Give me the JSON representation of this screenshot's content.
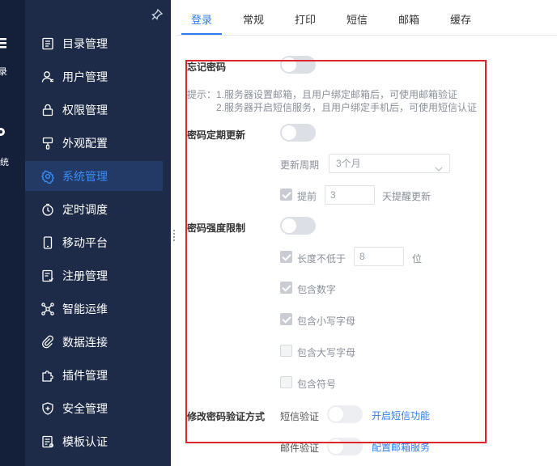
{
  "rail": {
    "items": [
      {
        "icon": "list-icon",
        "label": "录"
      },
      {
        "icon": "gear-icon",
        "label": "系统"
      }
    ]
  },
  "sidebar": {
    "pin_icon": "pin-icon",
    "items": [
      {
        "label": "目录管理",
        "icon": "catalog-icon"
      },
      {
        "label": "用户管理",
        "icon": "user-icon"
      },
      {
        "label": "权限管理",
        "icon": "lock-icon"
      },
      {
        "label": "外观配置",
        "icon": "brush-icon"
      },
      {
        "label": "系统管理",
        "icon": "gear-icon",
        "active": true
      },
      {
        "label": "定时调度",
        "icon": "timer-icon"
      },
      {
        "label": "移动平台",
        "icon": "mobile-icon"
      },
      {
        "label": "注册管理",
        "icon": "register-icon"
      },
      {
        "label": "智能运维",
        "icon": "ops-icon"
      },
      {
        "label": "数据连接",
        "icon": "link-icon"
      },
      {
        "label": "插件管理",
        "icon": "plugin-icon"
      },
      {
        "label": "安全管理",
        "icon": "shield-icon"
      },
      {
        "label": "模板认证",
        "icon": "template-icon"
      }
    ]
  },
  "tabs": [
    "登录",
    "常规",
    "打印",
    "短信",
    "邮箱",
    "缓存"
  ],
  "active_tab": "登录",
  "form": {
    "forgot_password": {
      "label": "忘记密码",
      "enabled": false
    },
    "hint_line1": "提示：1.服务器设置邮箱，且用户绑定邮箱后，可使用邮箱验证",
    "hint_line2": "2.服务器开启短信服务，且用户绑定手机后，可使用短信认证",
    "periodic_update": {
      "label": "密码定期更新",
      "enabled": false,
      "period_label": "更新周期",
      "period_value": "3个月",
      "remind_label": "提前",
      "remind_checked": true,
      "remind_days": "3",
      "remind_suffix": "天提醒更新"
    },
    "strength": {
      "label": "密码强度限制",
      "enabled": false,
      "length_label": "长度不低于",
      "length_checked": true,
      "length_value": "8",
      "length_unit": "位",
      "digits_label": "包含数字",
      "digits_checked": true,
      "lower_label": "包含小写字母",
      "lower_checked": true,
      "upper_label": "包含大写字母",
      "upper_checked": false,
      "symbol_label": "包含符号",
      "symbol_checked": false
    },
    "verify": {
      "label": "修改密码验证方式",
      "sms_label": "短信验证",
      "sms_enabled": false,
      "sms_link": "开启短信功能",
      "email_label": "邮件验证",
      "email_enabled": false,
      "email_link": "配置邮箱服务"
    }
  },
  "colors": {
    "accent": "#2f7df6",
    "sidebar_bg": "#1d2b48",
    "rail_bg": "#14203a",
    "highlight_frame": "#e0242b"
  }
}
